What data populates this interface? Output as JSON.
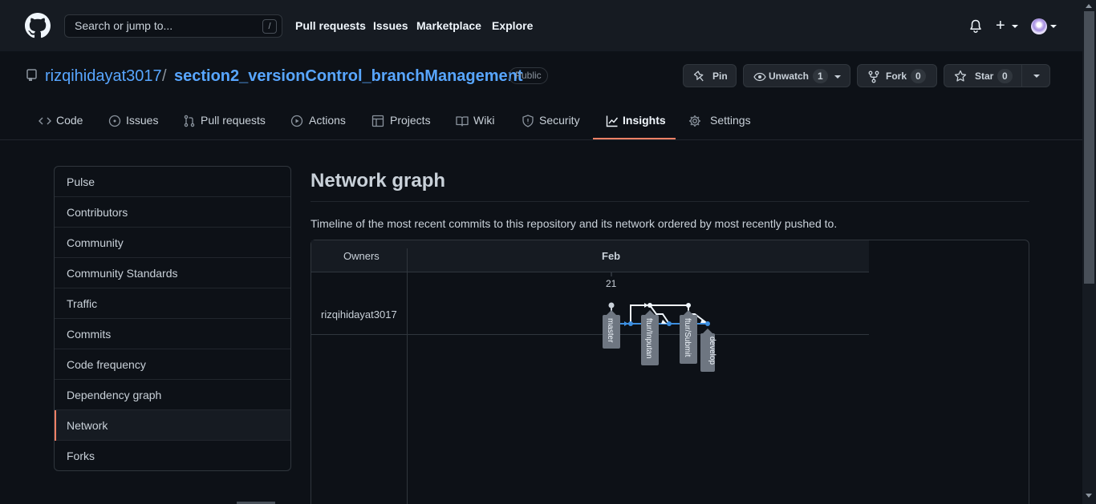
{
  "header": {
    "search_placeholder": "Search or jump to...",
    "search_shortcut": "/",
    "nav": [
      "Pull requests",
      "Issues",
      "Marketplace",
      "Explore"
    ]
  },
  "repo": {
    "owner": "rizqihidayat3017",
    "separator": "/",
    "name": "section2_versionControl_branchManagement",
    "visibility": "Public",
    "pin_label": "Pin",
    "unwatch_label": "Unwatch",
    "watch_count": "1",
    "fork_label": "Fork",
    "fork_count": "0",
    "star_label": "Star",
    "star_count": "0"
  },
  "tabs": [
    {
      "label": "Code",
      "icon": "code-icon"
    },
    {
      "label": "Issues",
      "icon": "issue-icon"
    },
    {
      "label": "Pull requests",
      "icon": "pull-request-icon"
    },
    {
      "label": "Actions",
      "icon": "play-icon"
    },
    {
      "label": "Projects",
      "icon": "table-icon"
    },
    {
      "label": "Wiki",
      "icon": "book-icon"
    },
    {
      "label": "Security",
      "icon": "shield-icon"
    },
    {
      "label": "Insights",
      "icon": "graph-icon"
    },
    {
      "label": "Settings",
      "icon": "gear-icon"
    }
  ],
  "active_tab": "Insights",
  "sidebar": {
    "items": [
      "Pulse",
      "Contributors",
      "Community",
      "Community Standards",
      "Traffic",
      "Commits",
      "Code frequency",
      "Dependency graph",
      "Network",
      "Forks"
    ],
    "selected": "Network"
  },
  "main": {
    "title": "Network graph",
    "description": "Timeline of the most recent commits to this repository and its network ordered by most recently pushed to."
  },
  "graph": {
    "owners_label": "Owners",
    "month": "Feb",
    "day": "21",
    "owner": "rizqihidayat3017",
    "branches": [
      "master",
      "ftur/Inputan",
      "ftur/Submit",
      "develop"
    ]
  },
  "colors": {
    "accent": "#f78166",
    "link": "#58a6ff",
    "commit": "#3d8fe0"
  }
}
